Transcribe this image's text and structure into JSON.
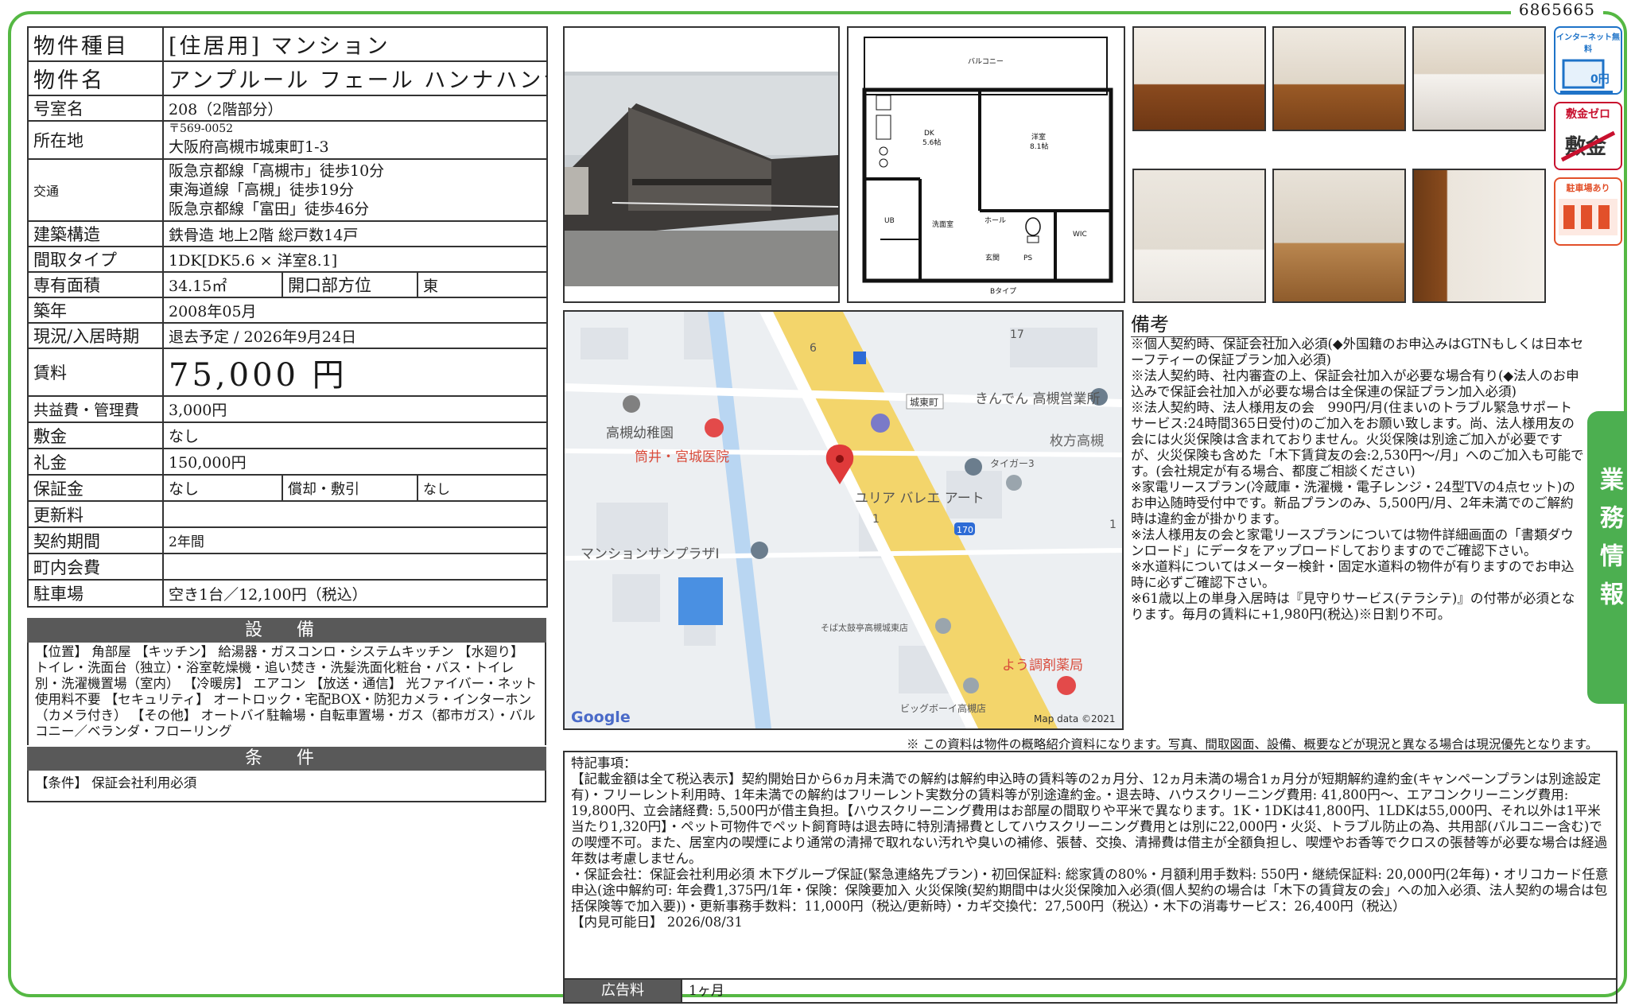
{
  "doc_id": "6865665",
  "spec": {
    "type_label": "物件種目",
    "type_value": "[住居用] マンション",
    "name_label": "物件名",
    "name_value": "アンプルール フェール ハンナハンナ",
    "room_label": "号室名",
    "room_value": "208（2階部分）",
    "addr_label": "所在地",
    "zip": "〒569-0052",
    "addr_value": "大阪府高槻市城東町1-3",
    "traffic_label": "交通",
    "traffic": [
      "阪急京都線「高槻市」徒歩10分",
      "東海道線「高槻」徒歩19分",
      "阪急京都線「富田」徒歩46分"
    ],
    "struct_label": "建築構造",
    "struct_value": "鉄骨造 地上2階 総戸数14戸",
    "layout_label": "間取タイプ",
    "layout_value": "1DK[DK5.6 × 洋室8.1]",
    "area_label": "専有面積",
    "area_value": "34.15㎡",
    "dir_label": "開口部方位",
    "dir_value": "東",
    "built_label": "築年",
    "built_value": "2008年05月",
    "status_label": "現況/入居時期",
    "status_value": "退去予定 / 2026年9月24日",
    "rent_label": "賃料",
    "rent_value": "75,000 円",
    "fee_label": "共益費・管理費",
    "fee_value": "3,000円",
    "deposit_label": "敷金",
    "deposit_value": "なし",
    "key_label": "礼金",
    "key_value": "150,000円",
    "guarantee_label": "保証金",
    "guarantee_value": "なし",
    "amort_label": "償却・敷引",
    "amort_value": "なし",
    "renew_label": "更新料",
    "renew_value": "",
    "term_label": "契約期間",
    "term_value": "2年間",
    "town_label": "町内会費",
    "town_value": "",
    "parking_label": "駐車場",
    "parking_value": "空き1台／12,100円（税込）"
  },
  "setsubi_title": "設 備",
  "setsubi_text": "【位置】 角部屋 【キッチン】 給湯器・ガスコンロ・システムキッチン 【水廻り】 トイレ・洗面台（独立）・浴室乾燥機・追い焚き・洗髪洗面化粧台・バス・トイレ別・洗濯機置場（室内） 【冷暖房】 エアコン 【放送・通信】 光ファイバー・ネット使用料不要 【セキュリティ】 オートロック・宅配BOX・防犯カメラ・インターホン（カメラ付き） 【その他】 オートバイ駐輪場・自転車置場・ガス（都市ガス）・バルコニー／ベランダ・フローリング",
  "joken_title": "条 件",
  "joken_text": "【条件】 保証会社利用必須",
  "floorplan": {
    "balcony": "バルコニー",
    "dk": "DK",
    "dk_size": "5.6帖",
    "yoshitsu": "洋室",
    "yoshitsu_size": "8.1帖",
    "hall": "ホール",
    "ub": "UB",
    "senmen": "洗面室",
    "genkan": "玄関",
    "ps": "PS",
    "wic": "WIC",
    "type": "Bタイプ"
  },
  "badges": {
    "internet": "インターネット無料",
    "internet_price": "0円",
    "shikikin": "敷金ゼロ",
    "shikikin_word": "敷金",
    "parking": "駐車場あり"
  },
  "map": {
    "labels": [
      "高槻幼稚園",
      "筒井・宮城医院",
      "きんでん 高槻営業所",
      "城東町",
      "枚方高槻",
      "タイガー3",
      "ユリア バレエ アート",
      "マンションサンプラザⅠ",
      "そば太鼓亭高槻城東店",
      "よう調剤薬局",
      "ビッグボーイ高槻店",
      "Google",
      "Map data ©2021",
      "6",
      "17",
      "1",
      "1",
      "170"
    ]
  },
  "bikou_title": "備考",
  "bikou_text": "※個人契約時、保証会社加入必須(◆外国籍のお申込みはGTNもしくは日本セーフティーの保証プラン加入必須)\n※法人契約時、社内審査の上、保証会社加入が必要な場合有り(◆法人のお申込みで保証会社加入が必要な場合は全保連の保証プラン加入必須)\n※法人契約時、法人様用友の会　990円/月(住まいのトラブル緊急サポートサービス:24時間365日受付)のご加入をお願い致します。尚、法人様用友の会には火災保険は含まれておりません。火災保険は別途ご加入が必要ですが、火災保険も含めた「木下賃貸友の会:2,530円～/月」へのご加入も可能です。(会社規定が有る場合、都度ご相談ください)\n※家電リースプラン(冷蔵庫・洗濯機・電子レンジ・24型TVの4点セット)のお申込随時受付中です。新品プランのみ、5,500円/月、2年未満でのご解約時は違約金が掛かります。\n※法人様用友の会と家電リースプランについては物件詳細画面の「書類ダウンロード」にデータをアップロードしておりますのでご確認下さい。\n※水道料についてはメーター検針・固定水道料の物件が有りますのでお申込時に必ずご確認下さい。\n※61歳以上の単身入居時は『見守りサービス(テラシテ)』の付帯が必須となります。毎月の賃料に+1,980円(税込)※日割り不可。",
  "side_label": "業務情報",
  "note": "※ この資料は物件の概略紹介資料になります。写真、間取図面、設備、概要などが現況と異なる場合は現況優先となります。",
  "tokki_title": "特記事項：",
  "tokki_text": "【記載金額は全て税込表示】契約開始日から6ヵ月未満での解約は解約申込時の賃料等の2ヵ月分、12ヵ月未満の場合1ヵ月分が短期解約違約金(キャンペーンプランは別途設定有)・フリーレント利用時、1年未満での解約はフリーレント実数分の賃料等が別途違約金。・退去時、ハウスクリーニング費用: 41,800円〜、エアコンクリーニング費用: 19,800円、立会諸経費: 5,500円が借主負担。【ハウスクリーニング費用はお部屋の間取りや平米で異なります。1K・1DKは41,800円、1LDKは55,000円、それ以外は1平米当たり1,320円】・ペット可物件でペット飼育時は退去時に特別清掃費としてハウスクリーニング費用とは別に22,000円・火災、トラブル防止の為、共用部(バルコニー含む)での喫煙不可。また、居室内の喫煙により通常の清掃で取れない汚れや臭いの補修、張替、交換、清掃費は借主が全額負担し、喫煙やお香等でクロスの張替等が必要な場合は経過年数は考慮しません。\n・保証会社：保証会社利用必須 木下グループ保証(緊急連絡先プラン)・初回保証料: 総家賃の80%・月額利用手数料: 550円・継続保証料: 20,000円(2年毎)・オリコカード任意申込(途中解約可: 年会費1,375円/1年・保険：保険要加入 火災保険(契約期間中は火災保険加入必須(個人契約の場合は「木下の賃貸友の会」への加入必須、法人契約の場合は包括保険等で加入要))・更新事務手数料：11,000円（税込/更新時）・カギ交換代：27,500円（税込）・木下の消毒サービス：26,400円（税込）\n【内見可能日】 2026/08/31",
  "ad_label": "広告料",
  "ad_value": "1ヶ月",
  "colors": {
    "frame": "#55b843",
    "header_bar": "#595959",
    "side_tab": "#4caf50",
    "badge_blue": "#1e73c8",
    "badge_red": "#c8102e",
    "badge_orange": "#e2502a",
    "map_road": "#f3d56b"
  }
}
